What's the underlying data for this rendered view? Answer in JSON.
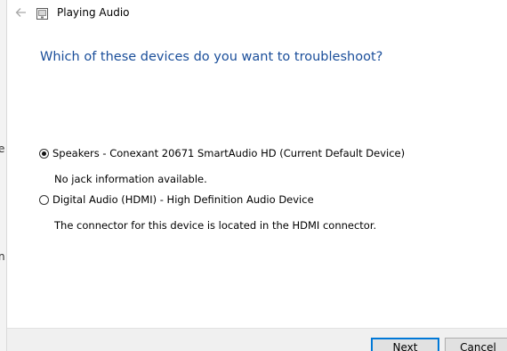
{
  "window": {
    "title": "Playing Audio"
  },
  "behind": {
    "chars": [
      "e",
      "n"
    ]
  },
  "main": {
    "heading": "Which of these devices do you want to troubleshoot?",
    "options": [
      {
        "label": "Speakers - Conexant 20671 SmartAudio HD (Current Default Device)",
        "description": "No jack information available.",
        "selected": true
      },
      {
        "label": "Digital Audio (HDMI) - High Definition Audio Device",
        "description": "The connector for this device is located in the HDMI connector.",
        "selected": false
      }
    ]
  },
  "footer": {
    "next_label": "Next",
    "cancel_label": "Cancel"
  },
  "colors": {
    "heading": "#1a4e9a",
    "focus_border": "#0078d7"
  },
  "icons": {
    "back": "back-arrow-icon",
    "app": "troubleshooter-app-icon"
  }
}
